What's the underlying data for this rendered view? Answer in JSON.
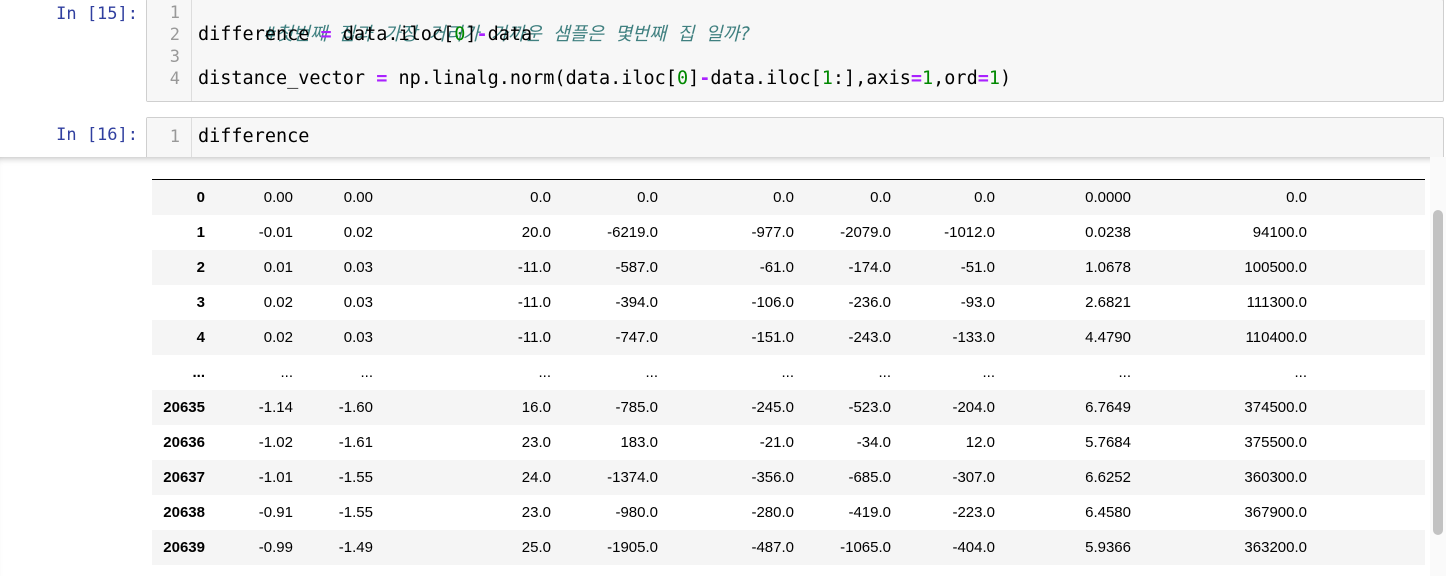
{
  "cells": [
    {
      "prompt": "In [15]:",
      "lines": [
        {
          "n": "1",
          "comment": "#첫번째 집과 가장 거리가 가까운 샘플은 몇번째 집 일까?"
        },
        {
          "n": "2",
          "parts": [
            "difference ",
            "=",
            " data.iloc[",
            "0",
            "]",
            "-",
            "data"
          ]
        },
        {
          "n": "3"
        },
        {
          "n": "4",
          "parts": [
            "distance_vector ",
            "=",
            " np.linalg.norm(data.iloc[",
            "0",
            "]",
            "-",
            "data.iloc[",
            "1",
            ":],axis",
            "=",
            "1",
            ",ord",
            "=",
            "1",
            ")"
          ]
        }
      ]
    },
    {
      "prompt": "In [16]:",
      "lines": [
        {
          "n": "1",
          "text": "difference"
        }
      ]
    }
  ],
  "table": {
    "rows": [
      {
        "index": "0",
        "cells": [
          "0.00",
          "0.00",
          "0.0",
          "0.0",
          "0.0",
          "0.0",
          "0.0",
          "0.0000",
          "0.0"
        ]
      },
      {
        "index": "1",
        "cells": [
          "-0.01",
          "0.02",
          "20.0",
          "-6219.0",
          "-977.0",
          "-2079.0",
          "-1012.0",
          "0.0238",
          "94100.0"
        ]
      },
      {
        "index": "2",
        "cells": [
          "0.01",
          "0.03",
          "-11.0",
          "-587.0",
          "-61.0",
          "-174.0",
          "-51.0",
          "1.0678",
          "100500.0"
        ]
      },
      {
        "index": "3",
        "cells": [
          "0.02",
          "0.03",
          "-11.0",
          "-394.0",
          "-106.0",
          "-236.0",
          "-93.0",
          "2.6821",
          "111300.0"
        ]
      },
      {
        "index": "4",
        "cells": [
          "0.02",
          "0.03",
          "-11.0",
          "-747.0",
          "-151.0",
          "-243.0",
          "-133.0",
          "4.4790",
          "110400.0"
        ]
      },
      {
        "index": "...",
        "cells": [
          "...",
          "...",
          "...",
          "...",
          "...",
          "...",
          "...",
          "...",
          "..."
        ]
      },
      {
        "index": "20635",
        "cells": [
          "-1.14",
          "-1.60",
          "16.0",
          "-785.0",
          "-245.0",
          "-523.0",
          "-204.0",
          "6.7649",
          "374500.0"
        ]
      },
      {
        "index": "20636",
        "cells": [
          "-1.02",
          "-1.61",
          "23.0",
          "183.0",
          "-21.0",
          "-34.0",
          "12.0",
          "5.7684",
          "375500.0"
        ]
      },
      {
        "index": "20637",
        "cells": [
          "-1.01",
          "-1.55",
          "24.0",
          "-1374.0",
          "-356.0",
          "-685.0",
          "-307.0",
          "6.6252",
          "360300.0"
        ]
      },
      {
        "index": "20638",
        "cells": [
          "-0.91",
          "-1.55",
          "23.0",
          "-980.0",
          "-280.0",
          "-419.0",
          "-223.0",
          "6.4580",
          "367900.0"
        ]
      },
      {
        "index": "20639",
        "cells": [
          "-0.99",
          "-1.49",
          "25.0",
          "-1905.0",
          "-487.0",
          "-1065.0",
          "-404.0",
          "5.9366",
          "363200.0"
        ]
      }
    ]
  },
  "colors": {
    "prompt": "#303F9F",
    "comment": "#408080",
    "operator": "#AA22FF",
    "number": "#008800",
    "editor_bg": "#f7f7f7",
    "row_alt": "#f5f5f5"
  }
}
